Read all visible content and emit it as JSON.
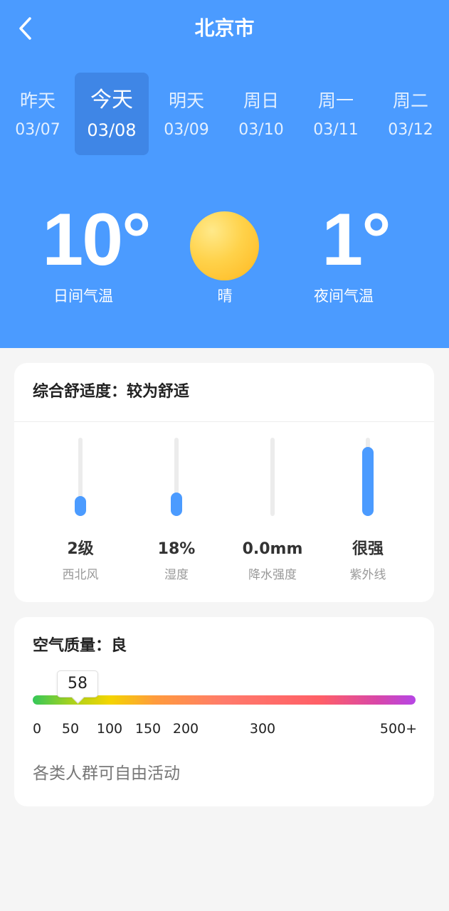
{
  "header": {
    "title": "北京市",
    "back_icon": "chevron-left-icon"
  },
  "days": [
    {
      "name": "昨天",
      "date": "03/07",
      "active": false
    },
    {
      "name": "今天",
      "date": "03/08",
      "active": true
    },
    {
      "name": "明天",
      "date": "03/09",
      "active": false
    },
    {
      "name": "周日",
      "date": "03/10",
      "active": false
    },
    {
      "name": "周一",
      "date": "03/11",
      "active": false
    },
    {
      "name": "周二",
      "date": "03/12",
      "active": false
    }
  ],
  "today": {
    "day_temp": "10°",
    "day_label": "日间气温",
    "condition": "晴",
    "condition_icon": "sun-icon",
    "night_temp": "1°",
    "night_label": "夜间气温"
  },
  "comfort": {
    "title": "综合舒适度：较为舒适",
    "metrics": [
      {
        "value": "2级",
        "label": "西北风",
        "level": 0.25
      },
      {
        "value": "18%",
        "label": "湿度",
        "level": 0.3
      },
      {
        "value": "0.0mm",
        "label": "降水强度",
        "level": 0
      },
      {
        "value": "很强",
        "label": "紫外线",
        "level": 0.88
      }
    ]
  },
  "air": {
    "title": "空气质量：良",
    "aqi": "58",
    "aqi_value": 58,
    "ticks": [
      "0",
      "50",
      "100",
      "150",
      "200",
      "300",
      "500+"
    ],
    "advice": "各类人群可自由活动"
  },
  "colors": {
    "primary": "#4b9bff",
    "active_day": "#3f86e6",
    "background": "#f5f5f5"
  }
}
